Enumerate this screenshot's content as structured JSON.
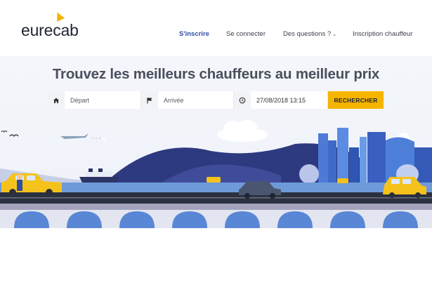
{
  "brand": {
    "logo_text": "eurecab",
    "accent": "#f5b400",
    "primary": "#2e4fa0"
  },
  "nav": {
    "signup": "S'inscrire",
    "login": "Se connecter",
    "faq": "Des questions ?",
    "driver_signup": "Inscription chauffeur"
  },
  "hero": {
    "headline": "Trouvez les meilleurs chauffeurs au meilleur prix"
  },
  "search": {
    "departure_placeholder": "Départ",
    "arrival_placeholder": "Arrivée",
    "datetime_value": "27/08/2018 13:15",
    "submit_label": "RECHERCHER",
    "icons": [
      "home-icon",
      "flag-icon",
      "clock-icon"
    ]
  }
}
